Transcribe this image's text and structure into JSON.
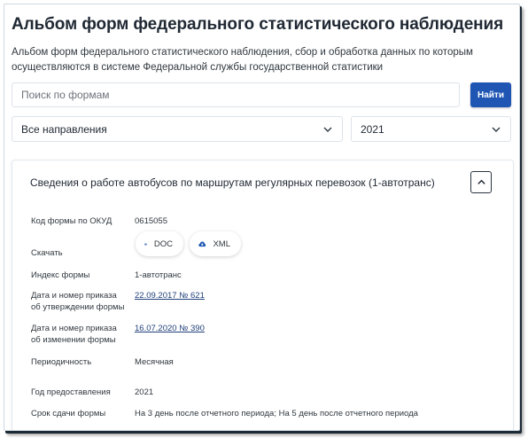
{
  "header": {
    "title": "Альбом форм федерального статистического наблюдения",
    "subtitle": "Альбом форм федерального статистического наблюдения, сбор и обработка данных по которым осуществляются в системе Федеральной службы государственной статистики"
  },
  "search": {
    "placeholder": "Поиск по формам",
    "value": "",
    "button_label": "Найти"
  },
  "filters": {
    "direction": "Все направления",
    "year": "2021"
  },
  "form_card": {
    "title": "Сведения о работе автобусов по маршрутам регулярных перевозок (1-автотранс)",
    "expanded": true,
    "fields": {
      "okud_label": "Код формы по ОКУД",
      "okud_value": "0615055",
      "download_label": "Скачать",
      "download_doc": "DOC",
      "download_xml": "XML",
      "index_label": "Индекс формы",
      "index_value": "1-автотранс",
      "approval_label": "Дата и номер приказа об утверждении формы",
      "approval_value": "22.09.2017 № 621",
      "change_label": "Дата и номер приказа об изменении формы",
      "change_value": "16.07.2020 № 390",
      "periodicity_label": "Периодичность",
      "periodicity_value": "Месячная",
      "year_label": "Год предоставления",
      "year_value": "2021",
      "deadline_label": "Срок сдачи формы",
      "deadline_value": "На 3 день после отчетного периода; На 5 день после отчетного периода"
    }
  },
  "colors": {
    "accent": "#1f56b4",
    "text": "#1f2833",
    "link": "#1f3f7a"
  },
  "icons": {
    "select_arrow": "chevron-down-icon",
    "collapse": "chevron-up-icon",
    "download": "cloud-download-icon"
  }
}
